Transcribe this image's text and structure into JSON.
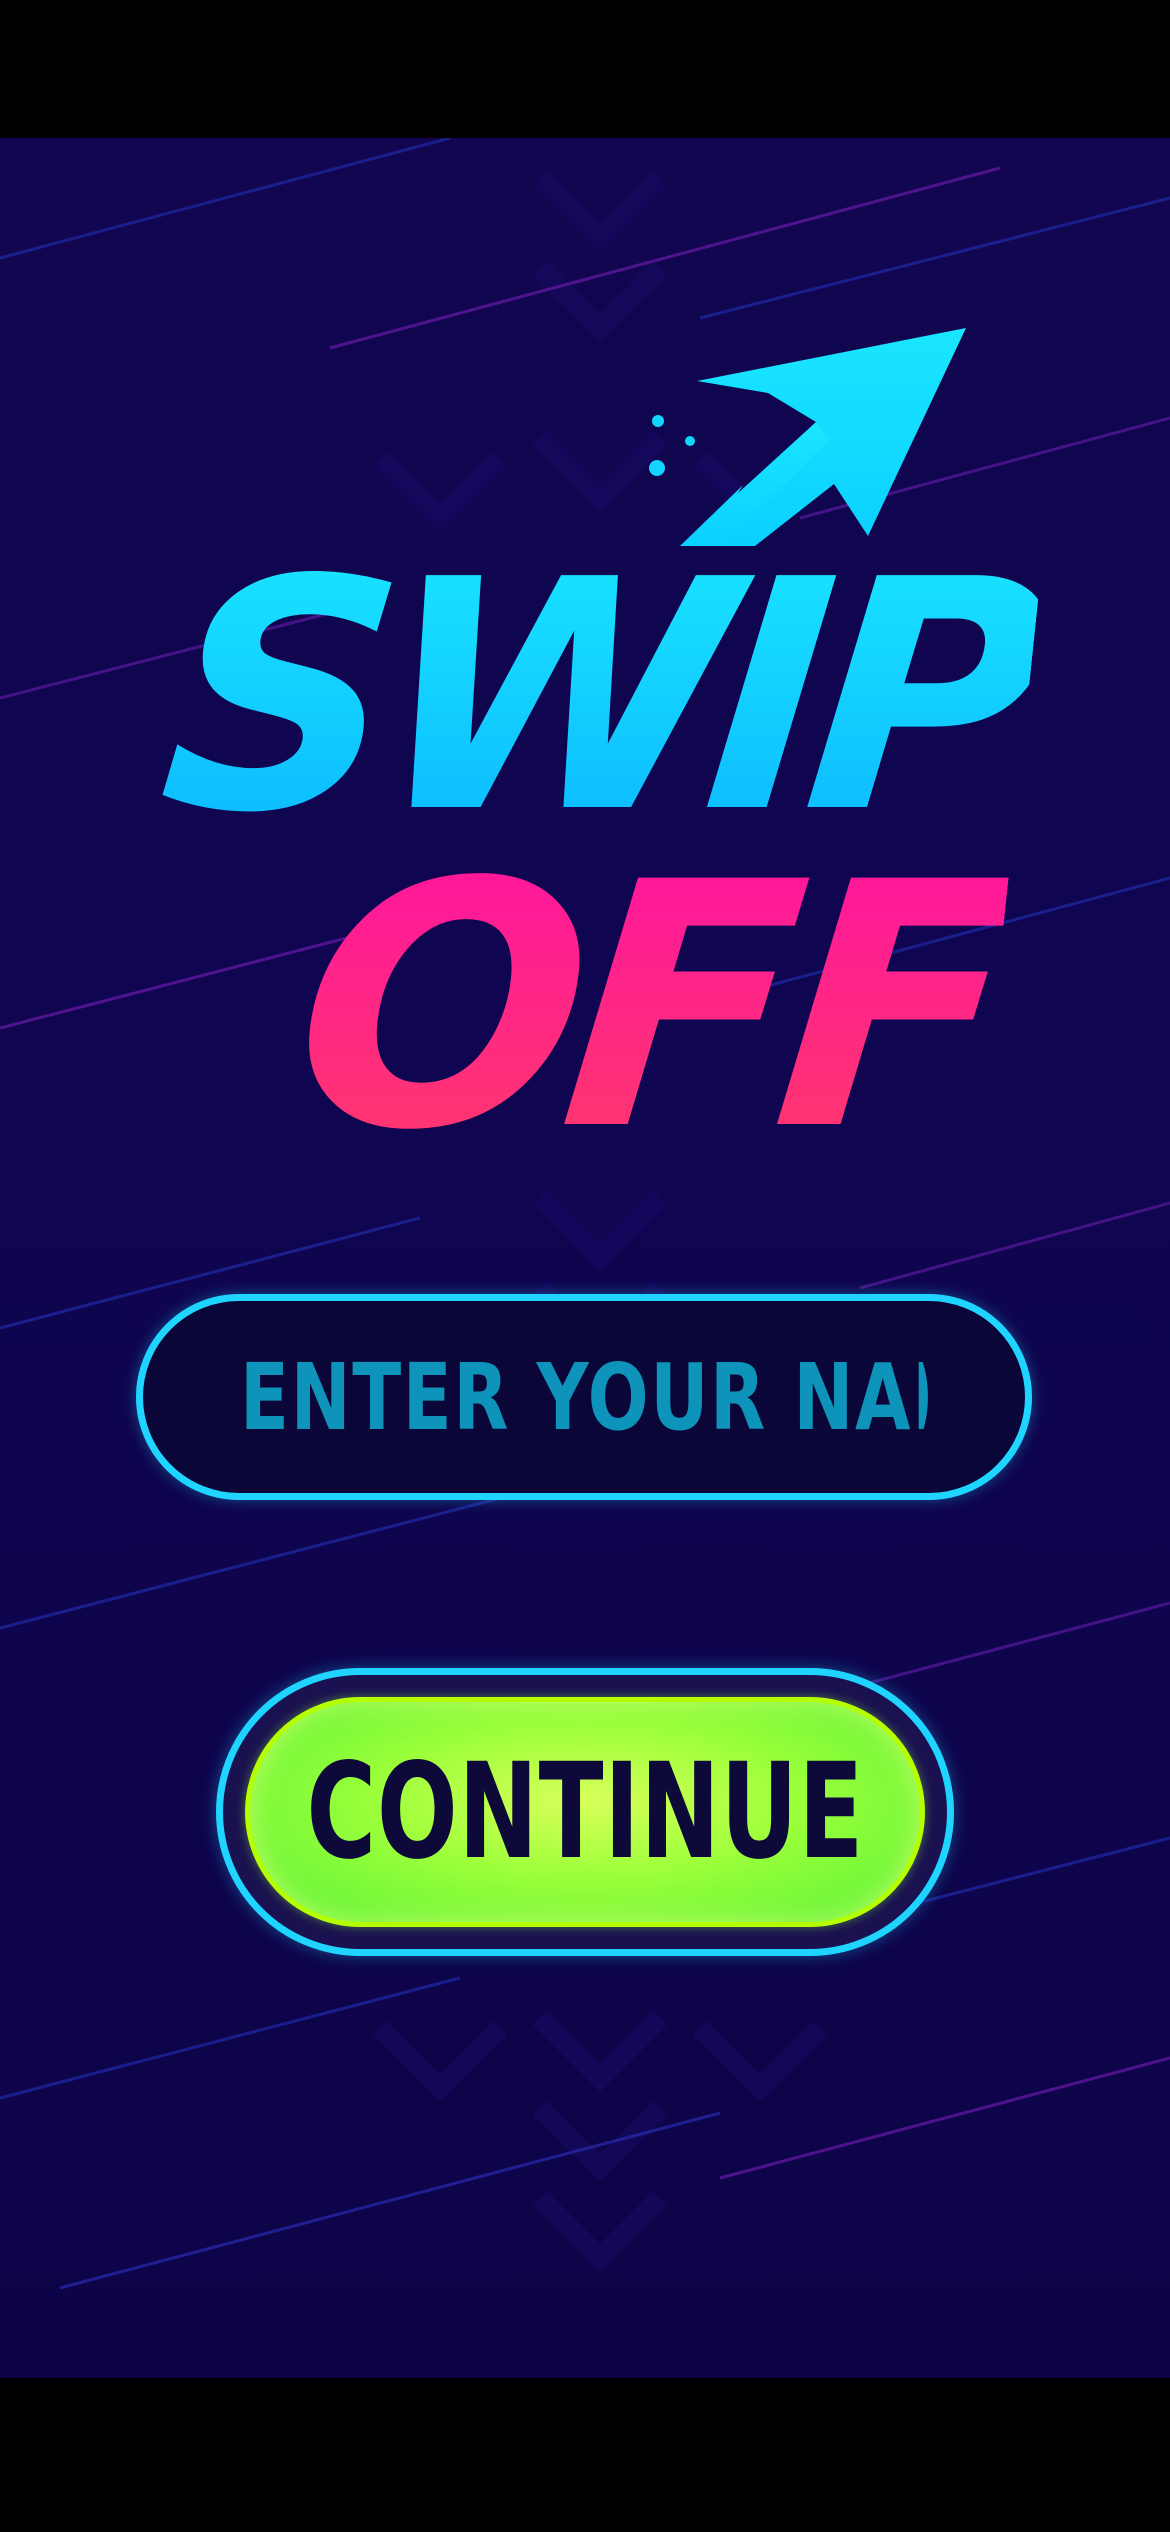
{
  "game": {
    "title_line1": "SWIPE",
    "title_line2": "OFF"
  },
  "name_field": {
    "placeholder": "ENTER YOUR NAME",
    "value": ""
  },
  "continue_button": {
    "label": "CONTINUE"
  },
  "colors": {
    "background": "#10064e",
    "title_cyan": "#12d4ff",
    "title_pink": "#ff1a8a",
    "field_border": "#1fd4ff",
    "field_text": "#0e93ba",
    "button_green": "#8cff3a",
    "button_text": "#0d0a3a"
  },
  "icons": {
    "logo_arrow": "arrow-up-right-icon"
  }
}
